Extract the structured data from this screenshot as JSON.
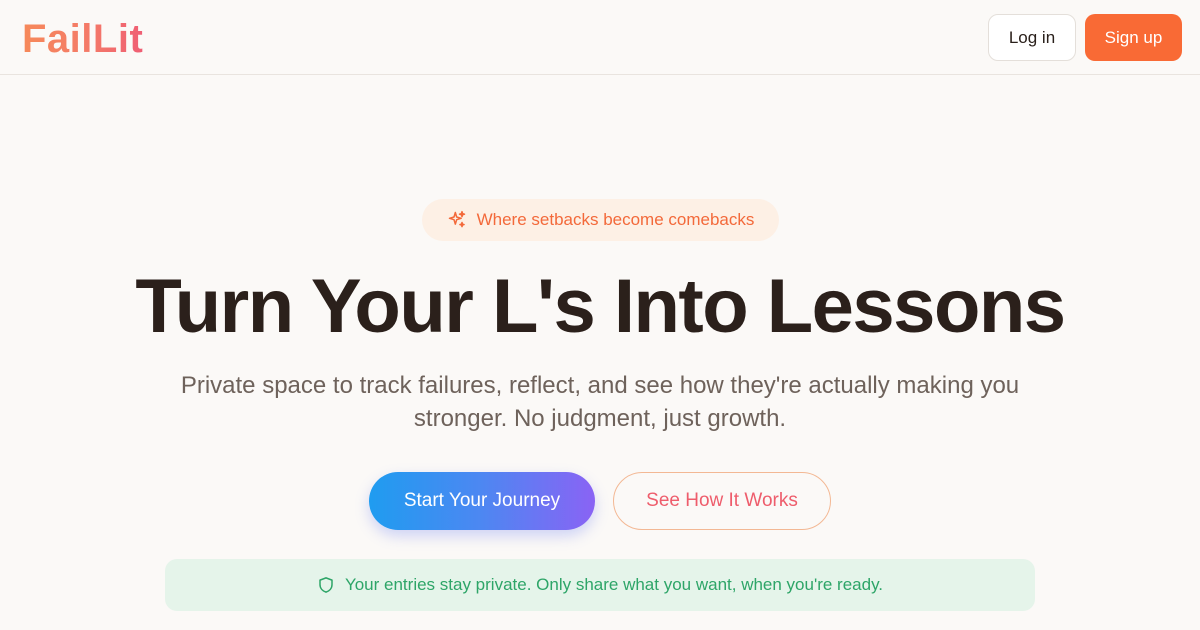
{
  "brand": {
    "name": "FailLit"
  },
  "nav": {
    "login_label": "Log in",
    "signup_label": "Sign up"
  },
  "hero": {
    "badge_icon": "sparkles-icon",
    "badge_text": "Where setbacks become comebacks",
    "title": "Turn Your L's Into Lessons",
    "subtitle": "Private space to track failures, reflect, and see how they're actually making you stronger. No judgment, just growth.",
    "primary_cta": "Start Your Journey",
    "secondary_cta": "See How It Works"
  },
  "privacy": {
    "icon": "shield-icon",
    "text": "Your entries stay private. Only share what you want, when you're ready."
  },
  "colors": {
    "accent_orange": "#f96a35",
    "badge_bg": "#fdf0e5",
    "privacy_green": "#2ea568",
    "privacy_bg": "#e5f4ea",
    "cta_gradient_start": "#1f9cf0",
    "cta_gradient_end": "#8a63f4"
  }
}
